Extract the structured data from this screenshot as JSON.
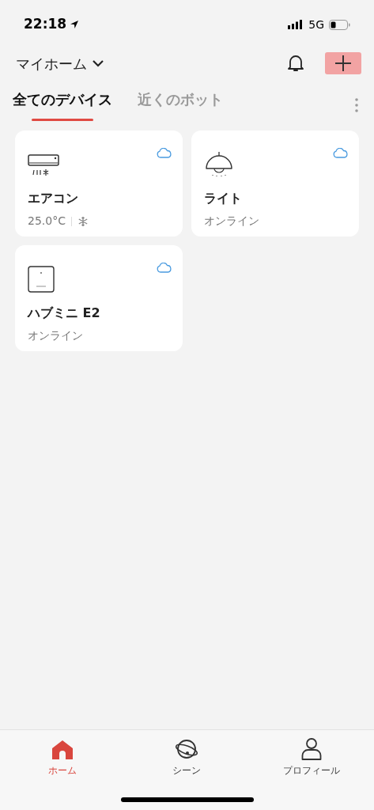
{
  "status_bar": {
    "time": "22:18",
    "network": "5G"
  },
  "header": {
    "home_name": "マイホーム",
    "add_highlighted": true
  },
  "tabs": [
    {
      "label": "全てのデバイス",
      "selected": true
    },
    {
      "label": "近くのボット",
      "selected": false
    }
  ],
  "devices": [
    {
      "kind": "aircon",
      "name": "エアコン",
      "status": "25.0°C",
      "cooling": true,
      "cloud": true
    },
    {
      "kind": "light",
      "name": "ライト",
      "status": "オンライン",
      "cloud": true
    },
    {
      "kind": "hub",
      "name": "ハブミニ E2",
      "status": "オンライン",
      "cloud": true
    }
  ],
  "nav": [
    {
      "kind": "home",
      "label": "ホーム",
      "selected": true
    },
    {
      "kind": "scene",
      "label": "シーン",
      "selected": false
    },
    {
      "kind": "profile",
      "label": "プロフィール",
      "selected": false
    }
  ]
}
